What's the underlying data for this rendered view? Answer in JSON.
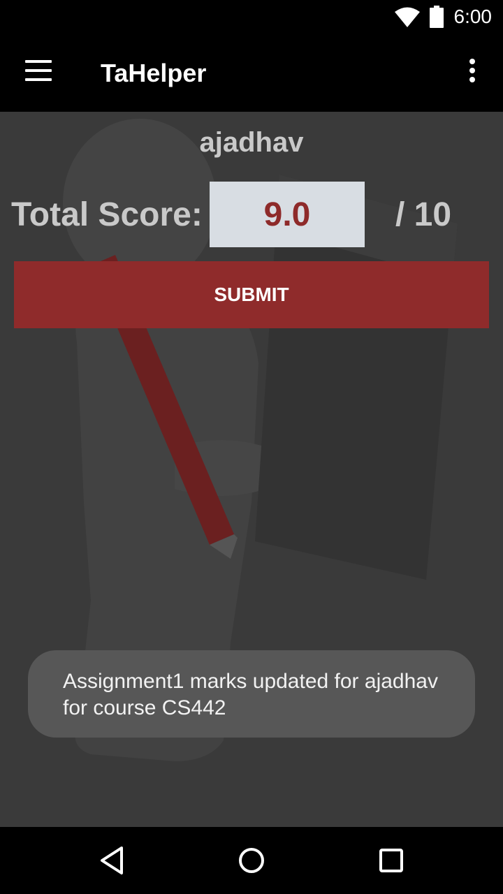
{
  "status_bar": {
    "time": "6:00",
    "icons": [
      "wifi-icon",
      "battery-icon"
    ]
  },
  "app_bar": {
    "title": "TaHelper",
    "icons": [
      "menu-icon",
      "overflow-menu-icon"
    ]
  },
  "main": {
    "student_name": "ajadhav",
    "score_label": "Total Score:",
    "score_value": "9.0",
    "score_max": "/ 10",
    "submit_label": "SUBMIT"
  },
  "toast": {
    "line1": "Assignment1 marks updated for ajadhav",
    "line2": "for course CS442"
  },
  "nav_bar": {
    "icons": [
      "back-icon",
      "home-icon",
      "recents-icon"
    ]
  },
  "colors": {
    "accent": "#8f2b2b",
    "score_text": "#8e2a2a",
    "background": "#3a3a3a",
    "toast": "#575757"
  }
}
